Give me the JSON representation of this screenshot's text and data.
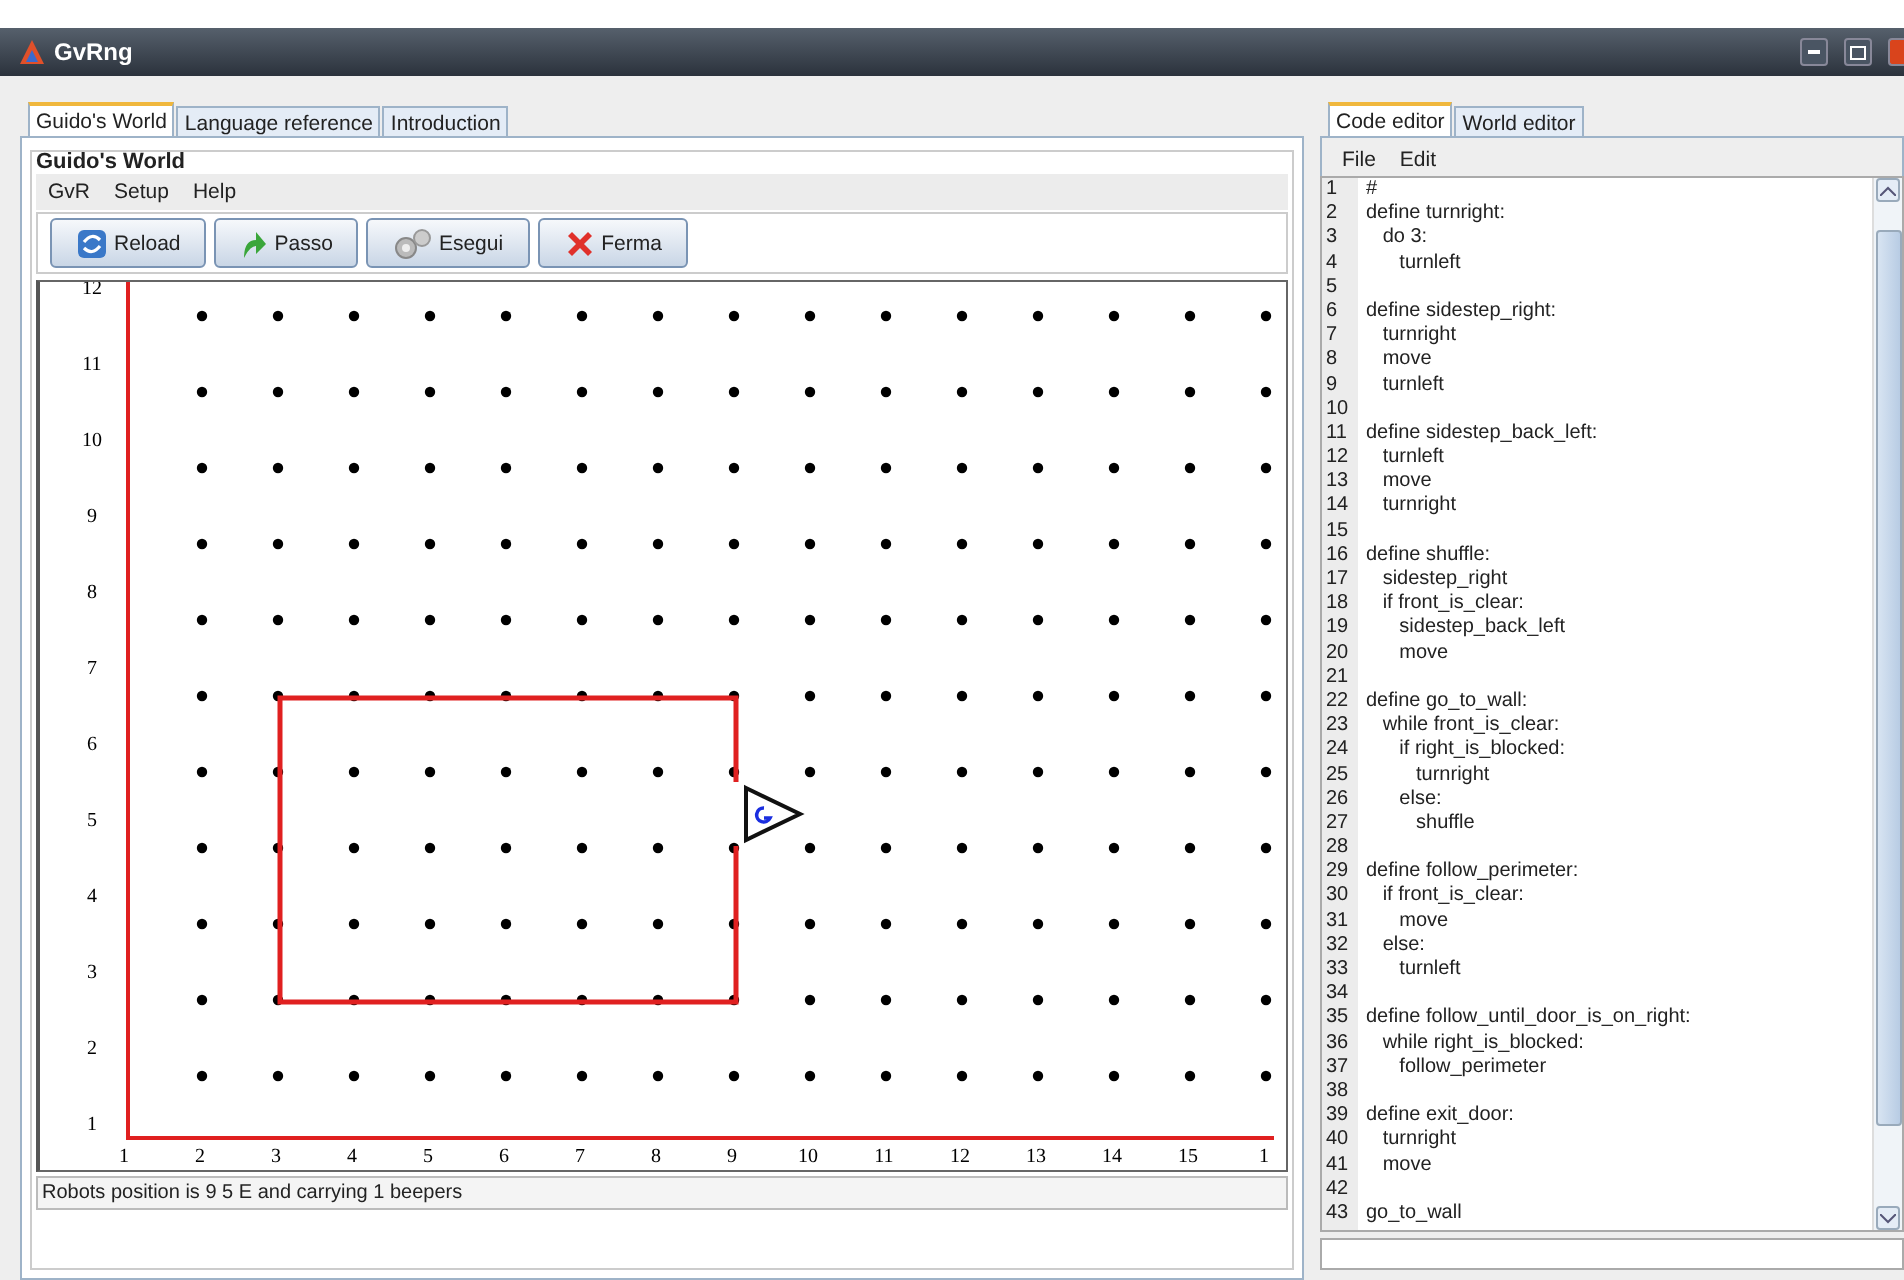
{
  "window": {
    "title": "GvRng"
  },
  "left_tabs": [
    {
      "label": "Guido's World",
      "selected": true
    },
    {
      "label": "Language reference",
      "selected": false
    },
    {
      "label": "Introduction",
      "selected": false
    }
  ],
  "world_panel": {
    "title": "Guido's World",
    "menu": [
      "GvR",
      "Setup",
      "Help"
    ],
    "toolbar": [
      {
        "kind": "reload",
        "label": "Reload"
      },
      {
        "kind": "step",
        "label": "Passo"
      },
      {
        "kind": "run",
        "label": "Esegui"
      },
      {
        "kind": "stop",
        "label": "Ferma"
      }
    ],
    "x_labels": [
      "1",
      "2",
      "3",
      "4",
      "5",
      "6",
      "7",
      "8",
      "9",
      "10",
      "11",
      "12",
      "13",
      "14",
      "15",
      "1"
    ],
    "y_labels": [
      "12",
      "11",
      "10",
      "9",
      "8",
      "7",
      "6",
      "5",
      "4",
      "3",
      "2",
      "1"
    ],
    "status_bar": "Robots position is 9 5 E and carrying 1 beepers"
  },
  "right_tabs": [
    {
      "label": "Code editor",
      "selected": true
    },
    {
      "label": "World editor",
      "selected": false
    }
  ],
  "editor_menu": [
    "File",
    "Edit"
  ],
  "code_lines": [
    {
      "number": "1",
      "text": "#"
    },
    {
      "number": "2",
      "text": "define turnright:"
    },
    {
      "number": "3",
      "text": "   do 3:"
    },
    {
      "number": "4",
      "text": "      turnleft"
    },
    {
      "number": "5"
    },
    {
      "number": "6",
      "text": "define sidestep_right:"
    },
    {
      "number": "7",
      "text": "   turnright"
    },
    {
      "number": "8",
      "text": "   move"
    },
    {
      "number": "9",
      "text": "   turnleft"
    },
    {
      "number": "10"
    },
    {
      "number": "11",
      "text": "define sidestep_back_left:"
    },
    {
      "number": "12",
      "text": "   turnleft"
    },
    {
      "number": "13",
      "text": "   move"
    },
    {
      "number": "14",
      "text": "   turnright"
    },
    {
      "number": "15"
    },
    {
      "number": "16",
      "text": "define shuffle:"
    },
    {
      "number": "17",
      "text": "   sidestep_right"
    },
    {
      "number": "18",
      "text": "   if front_is_clear:"
    },
    {
      "number": "19",
      "text": "      sidestep_back_left"
    },
    {
      "number": "20",
      "text": "      move"
    },
    {
      "number": "21"
    },
    {
      "number": "22",
      "text": "define go_to_wall:"
    },
    {
      "number": "23",
      "text": "   while front_is_clear:"
    },
    {
      "number": "24",
      "text": "      if right_is_blocked:"
    },
    {
      "number": "25",
      "text": "         turnright"
    },
    {
      "number": "26",
      "text": "      else:"
    },
    {
      "number": "27",
      "text": "         shuffle"
    },
    {
      "number": "28"
    },
    {
      "number": "29",
      "text": "define follow_perimeter:"
    },
    {
      "number": "30",
      "text": "   if front_is_clear:"
    },
    {
      "number": "31",
      "text": "      move"
    },
    {
      "number": "32",
      "text": "   else:"
    },
    {
      "number": "33",
      "text": "      turnleft"
    },
    {
      "number": "34"
    },
    {
      "number": "35",
      "text": "define follow_until_door_is_on_right:"
    },
    {
      "number": "36",
      "text": "   while right_is_blocked:"
    },
    {
      "number": "37",
      "text": "      follow_perimeter"
    },
    {
      "number": "38"
    },
    {
      "number": "39",
      "text": "define exit_door:"
    },
    {
      "number": "40",
      "text": "   turnright"
    },
    {
      "number": "41",
      "text": "   move"
    },
    {
      "number": "42"
    },
    {
      "number": "43",
      "text": "go_to_wall"
    }
  ]
}
